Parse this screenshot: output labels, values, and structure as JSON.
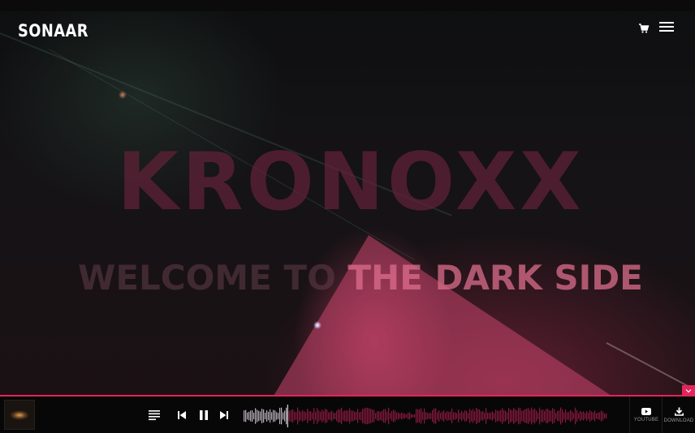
{
  "header": {
    "logo": "SONAAR",
    "cart_icon": "cart-icon",
    "menu_icon": "hamburger-menu-icon"
  },
  "hero": {
    "title": "KRONOXX",
    "subtitle_dim": "WELCOME TO ",
    "subtitle_highlight": "THE DARK SIDE"
  },
  "player": {
    "collapse_icon": "chevron-down-icon",
    "playlist_icon": "playlist-icon",
    "prev_icon": "skip-previous-icon",
    "pause_icon": "pause-icon",
    "next_icon": "skip-next-icon",
    "progress": 0.12,
    "buttons": {
      "youtube_label": "YOUTUBE",
      "download_label": "DOWNLOAD"
    }
  },
  "colors": {
    "accent": "#e4245a",
    "played_wave": "#b8b0b8",
    "unplayed_wave": "#8a1a3e"
  }
}
